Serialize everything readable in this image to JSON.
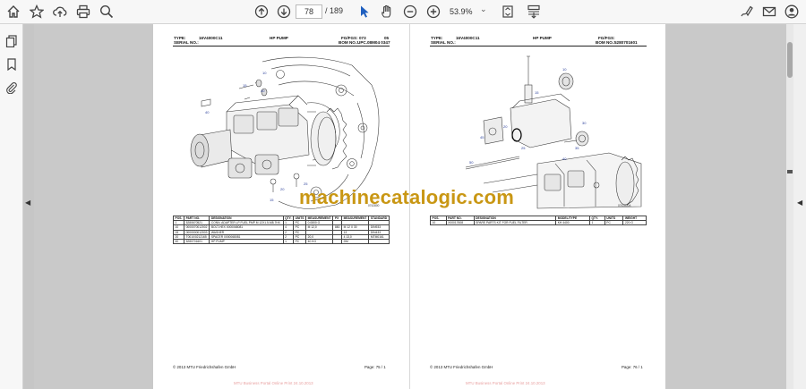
{
  "toolbar": {
    "page_current": "78",
    "page_total": "/ 189",
    "zoom": "53.9%"
  },
  "icons": {
    "home": "home-icon",
    "bookmark": "bookmark-icon",
    "upload": "upload-cloud-icon",
    "print": "print-icon",
    "zoom": "zoom-icon",
    "page_up": "page-up-icon",
    "page_down": "page-down-icon",
    "select": "cursor-icon",
    "hand": "hand-icon",
    "zoom_out": "zoom-out-icon",
    "zoom_in": "zoom-in-icon",
    "fit": "fit-page-icon",
    "scroll": "scroll-mode-icon",
    "sign": "sign-icon",
    "mail": "mail-icon",
    "account": "account-icon",
    "thumbnails": "thumbnails-icon",
    "bookmarks_panel": "bookmarks-panel-icon",
    "attachments": "attachment-icon"
  },
  "left_page": {
    "type_label": "TYPE:",
    "type_value": "16V4000C11",
    "serial_label": "SERIAL NO.:",
    "title": "HP PUMP",
    "fg_label": "FG/FGS:",
    "fg_value": "073",
    "fg_suffix": "05",
    "bom_label": "BOM NO.:",
    "bom_value": "UPC.08M04 0347",
    "drawing_code": "0742800",
    "callouts": [
      "10",
      "15",
      "40",
      "20",
      "25",
      "40",
      "15"
    ],
    "table_headers": [
      "POS.",
      "PART NO.",
      "DESIGNATION",
      "QTY.",
      "UNITS",
      "MEASUREMENT",
      "PX",
      "MEASUREMENT",
      "STANDARD"
    ],
    "rows": [
      [
        "1",
        "5280670521",
        "CONN. ADAPTER LP FUEL PMP M 12X1.5-M8.7HX",
        "1",
        "PC",
        "0.0800 G",
        "",
        "",
        ""
      ],
      [
        "10",
        "0000070012002",
        "BOLT-HEX 0000068081",
        "4",
        "PC",
        "M 12,0",
        "880",
        "M 12 X 30",
        "DIN933"
      ],
      [
        "15",
        "0000000012003",
        "WASHER",
        "2",
        "PC",
        "",
        "",
        "13",
        "DIN433"
      ],
      [
        "20",
        "T0010/0212165",
        "SPACER 0000068081",
        "2",
        "PC",
        "20,0",
        "",
        "4 13,0",
        "MTM0161"
      ],
      [
        "40",
        "5280701601",
        "HP PUMP",
        "1",
        "PC",
        "40 KG",
        "",
        "DM",
        ""
      ]
    ],
    "footer_left": "© 2013 MTU Friedrichshafen GmbH",
    "footer_right": "Page: 75 / 1",
    "strip": "MTU Business Portal Online Print 24.10.2013"
  },
  "right_page": {
    "type_label": "TYPE:",
    "type_value": "16V4000C11",
    "serial_label": "SERIAL NO.:",
    "title": "HP PUMP",
    "fg_label": "FG/FGS:",
    "fg_value": "",
    "bom_label": "BOM NO.:",
    "bom_value": "5280701601",
    "drawing_code": "0742800A",
    "table_headers": [
      "POS.",
      "PART NO.",
      "DESIGNATION",
      "MODEL/TYPE",
      "QTY.",
      "UNITS",
      "WEIGHT"
    ],
    "rows": [
      [
        "10",
        "X00017608",
        "SPARE PARTS KIT FOR FUEL FILTER",
        "KH 4400",
        "1",
        "PC",
        "220 G"
      ]
    ],
    "footer_left": "© 2013 MTU Friedrichshafen GmbH",
    "footer_right": "Page: 76 / 1",
    "strip": "MTU Business Portal Online Print 24.10.2013"
  },
  "watermark": "machinecatalogic.com"
}
